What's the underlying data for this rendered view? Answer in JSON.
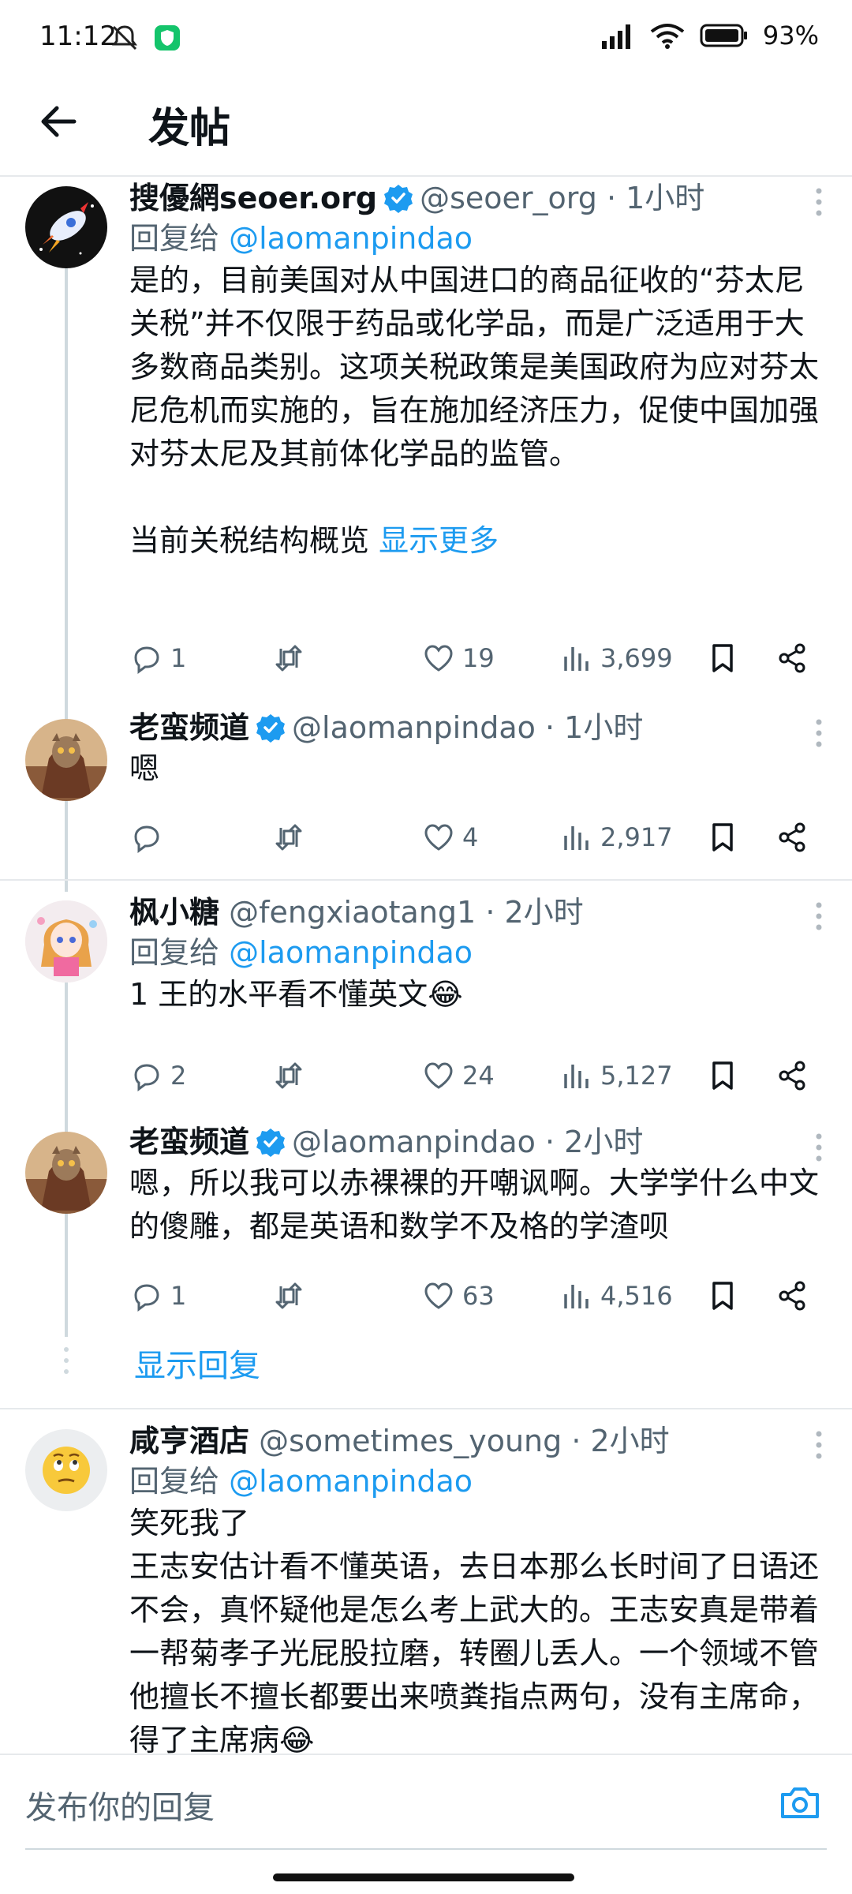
{
  "status_bar": {
    "time": "11:12",
    "battery": "93%"
  },
  "header": {
    "title": "发帖"
  },
  "tweets": [
    {
      "name": "搜優網seoer.org",
      "handle": "@seoer_org",
      "time": "· 1小时",
      "reply_to_prefix": "回复给",
      "reply_to": "@laomanpindao",
      "text": "是的，目前美国对从中国进口的商品征收的“芬太尼关税”并不仅限于药品或化学品，而是广泛适用于大多数商品类别。这项关税政策是美国政府为应对芬太尼危机而实施的，旨在施加经济压力，促使中国加强对芬太尼及其前体化学品的监管。\n\n当前关税结构概览 ",
      "show_more": "显示更多",
      "replies": "1",
      "retweets": "",
      "likes": "19",
      "views": "3,699"
    },
    {
      "name": "老蛮频道",
      "handle": "@laomanpindao",
      "time": "· 1小时",
      "text": "嗯",
      "replies": "",
      "retweets": "",
      "likes": "4",
      "views": "2,917"
    },
    {
      "name": "枫小糖",
      "handle": "@fengxiaotang1",
      "time": "· 2小时",
      "reply_to_prefix": "回复给",
      "reply_to": "@laomanpindao",
      "text": "1 王的水平看不懂英文😂",
      "replies": "2",
      "retweets": "",
      "likes": "24",
      "views": "5,127"
    },
    {
      "name": "老蛮频道",
      "handle": "@laomanpindao",
      "time": "· 2小时",
      "text": "嗯，所以我可以赤裸裸的开嘲讽啊。大学学什么中文的傻雕，都是英语和数学不及格的学渣呗",
      "replies": "1",
      "retweets": "",
      "likes": "63",
      "views": "4,516"
    },
    {
      "name": "咸亨酒店",
      "handle": "@sometimes_young",
      "time": "· 2小时",
      "reply_to_prefix": "回复给",
      "reply_to": "@laomanpindao",
      "text": "笑死我了\n王志安估计看不懂英语，去日本那么长时间了日语还不会，真怀疑他是怎么考上武大的。王志安真是带着一帮菊孝子光屁股拉磨，转圈儿丢人。一个领域不管他擅长不擅长都要出来喷粪指点两句，没有主席命，得了主席病😂"
    }
  ],
  "show_replies": "显示回复",
  "composer": {
    "placeholder": "发布你的回复"
  },
  "colors": {
    "accent": "#1d9bf0",
    "text": "#0f1419",
    "secondary": "#536471",
    "divider": "#e6e9ec"
  },
  "icons": [
    "back-arrow-icon",
    "verified-badge-icon",
    "reply-icon",
    "retweet-icon",
    "like-icon",
    "views-icon",
    "bookmark-icon",
    "share-icon",
    "more-icon",
    "camera-icon"
  ]
}
